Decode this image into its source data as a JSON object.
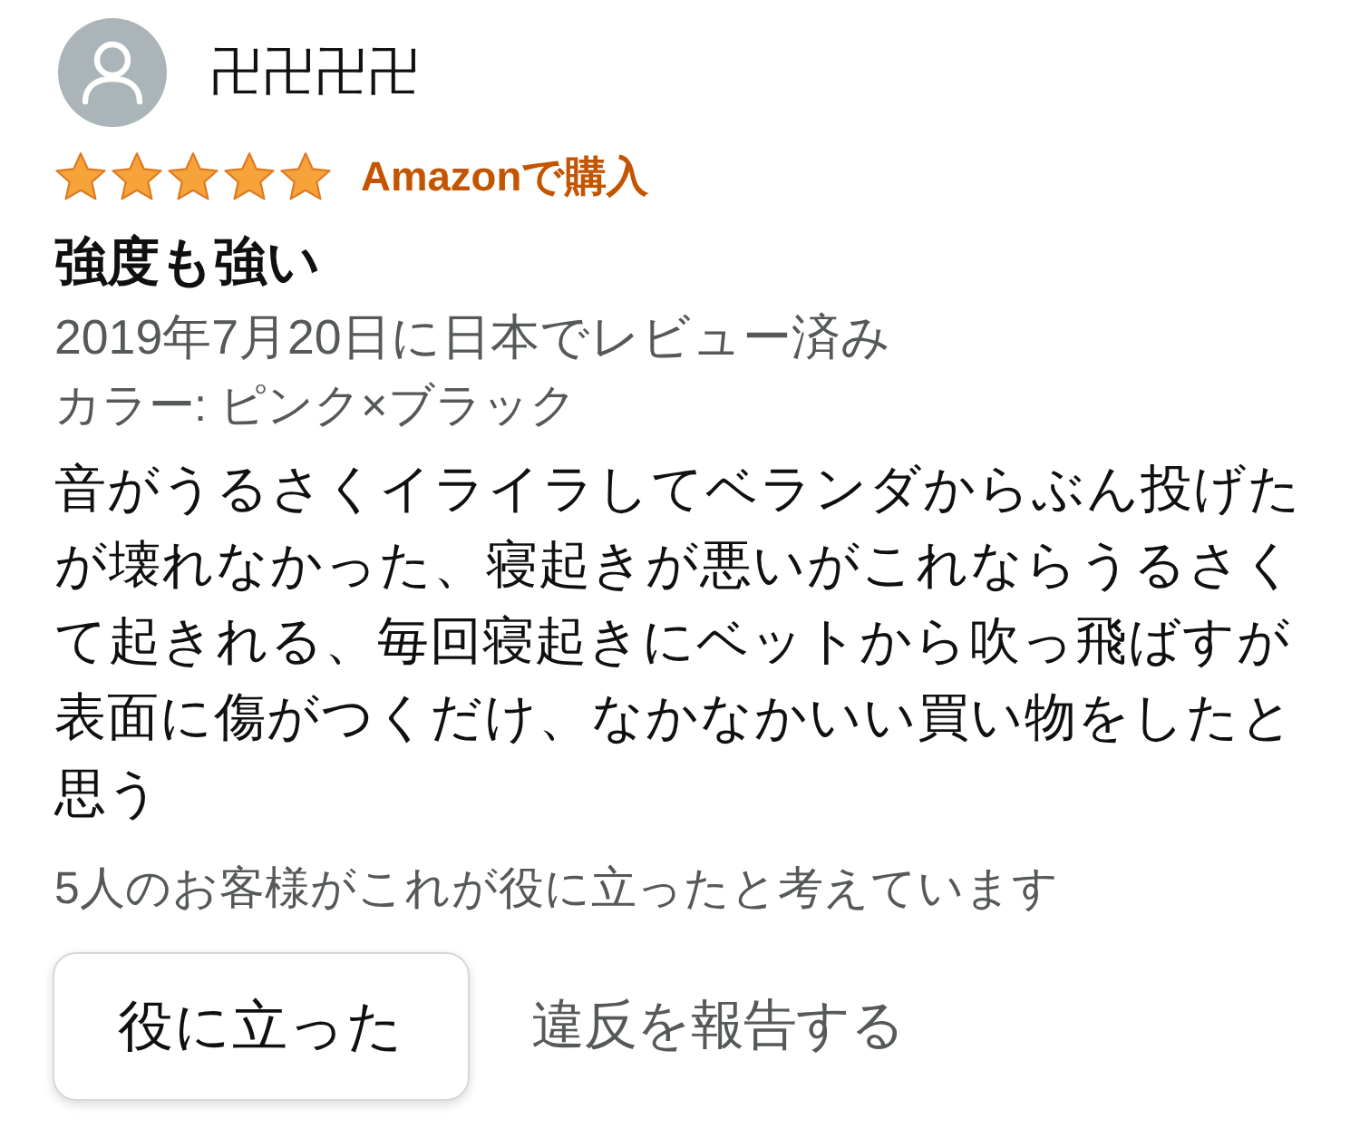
{
  "reviewer": {
    "name": "卍卍卍卍"
  },
  "review": {
    "stars": 5,
    "badge": "Amazonで購入",
    "title": "強度も強い",
    "date": "2019年7月20日に日本でレビュー済み",
    "variant": "カラー: ピンク×ブラック",
    "body": "音がうるさくイライラしてベランダからぶん投げたが壊れなかった、寝起きが悪いがこれならうるさくて起きれる、毎回寝起きにベットから吹っ飛ばすが表面に傷がつくだけ、なかなかいい買い物をしたと思う"
  },
  "helpful_count": "5人のお客様がこれが役に立ったと考えています",
  "actions": [
    {
      "kind": "button",
      "label": "役に立った"
    },
    {
      "kind": "link",
      "label": "違反を報告する"
    }
  ]
}
